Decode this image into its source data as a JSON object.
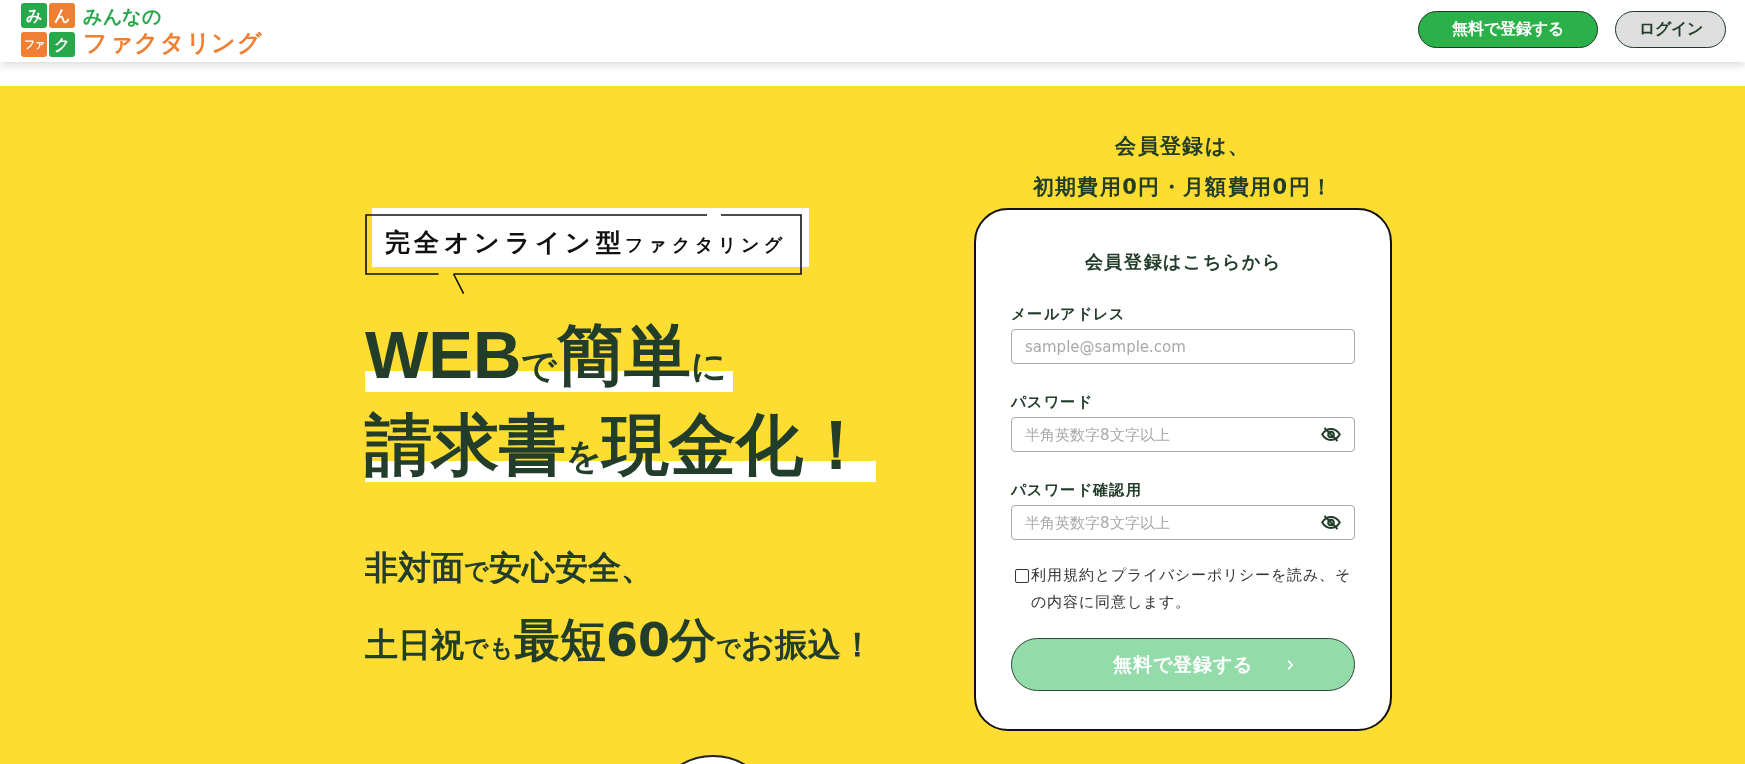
{
  "header": {
    "logo": {
      "tiles": [
        {
          "text": "み",
          "color": "#27a84a"
        },
        {
          "text": "ん",
          "color": "#ee7f33"
        },
        {
          "text": "ファ",
          "color": "#ee7f33"
        },
        {
          "text": "ク",
          "color": "#27a84a"
        }
      ],
      "tagline": "みんなの",
      "name": "ファクタリング"
    },
    "buttons": [
      {
        "label": "無料で登録する",
        "kind": "primary"
      },
      {
        "label": "ログイン",
        "kind": "secondary"
      }
    ]
  },
  "hero": {
    "badge": [
      {
        "text": "完全オンライン型",
        "kind": "large"
      },
      {
        "text": "ファクタリング",
        "kind": "small"
      }
    ],
    "headline": [
      {
        "segments": [
          {
            "text": "WEB",
            "kind": "large"
          },
          {
            "text": "で",
            "kind": "small"
          },
          {
            "text": "簡単",
            "kind": "large"
          },
          {
            "text": "に",
            "kind": "small"
          }
        ]
      },
      {
        "segments": [
          {
            "text": "請求書",
            "kind": "large"
          },
          {
            "text": "を",
            "kind": "small"
          },
          {
            "text": "現金化！",
            "kind": "large"
          }
        ]
      }
    ],
    "subheadline": [
      {
        "segments": [
          {
            "text": "非対面",
            "kind": "medium"
          },
          {
            "text": "で",
            "kind": "small"
          },
          {
            "text": "安心安全、",
            "kind": "medium"
          }
        ]
      },
      {
        "segments": [
          {
            "text": "土日祝",
            "kind": "medium"
          },
          {
            "text": "でも",
            "kind": "small"
          },
          {
            "text": "最短60分",
            "kind": "large"
          },
          {
            "text": "で",
            "kind": "small"
          },
          {
            "text": "お振込！",
            "kind": "medium"
          }
        ]
      }
    ]
  },
  "signup": {
    "intro": [
      "会員登録は、",
      "初期費用0円・月額費用0円！"
    ],
    "title": "会員登録はこちらから",
    "fields": [
      {
        "label": "メールアドレス",
        "placeholder": "sample@sample.com",
        "kind": "email"
      },
      {
        "label": "パスワード",
        "placeholder": "半角英数字8文字以上",
        "kind": "password"
      },
      {
        "label": "パスワード確認用",
        "placeholder": "半角英数字8文字以上",
        "kind": "password"
      }
    ],
    "agreement": {
      "text": "利用規約とプライバシーポリシーを読み、その内容に同意します。",
      "checked": false
    },
    "submit": {
      "label": "無料で登録する",
      "disabled": true
    }
  }
}
